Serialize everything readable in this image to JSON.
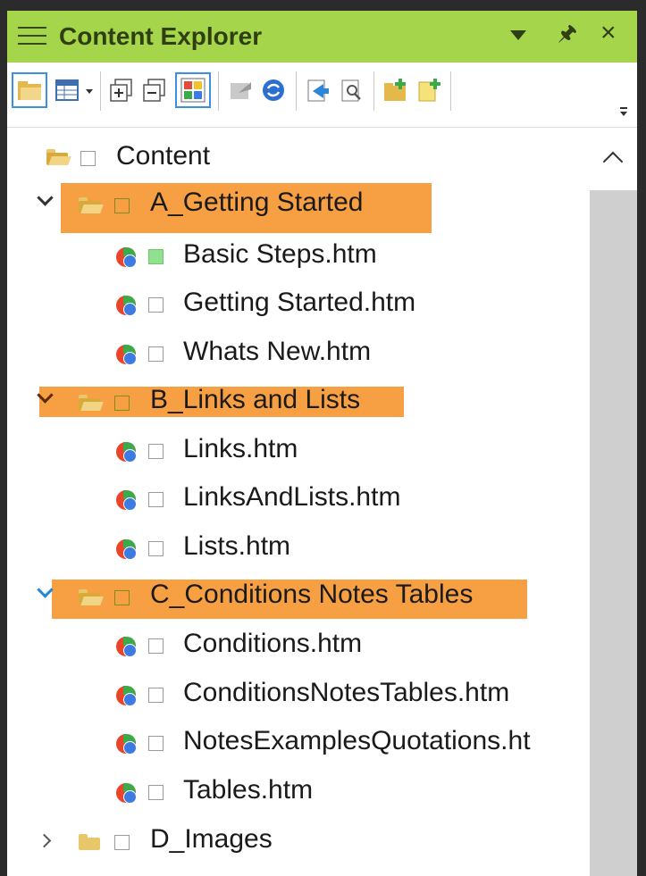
{
  "panel": {
    "title": "Content Explorer",
    "title_buttons": [
      "dropdown-icon",
      "pin-icon",
      "close-icon"
    ]
  },
  "toolbar": {
    "buttons": [
      "new-folder-icon",
      "view-options-icon",
      "expand-all-icon",
      "collapse-all-icon",
      "color-grid-icon",
      "disabled-arrow-icon",
      "refresh-icon",
      "export-icon",
      "find-icon",
      "add-folder-icon",
      "add-file-icon"
    ]
  },
  "tree": {
    "root": {
      "label": "Content"
    },
    "folders": [
      {
        "label": "A_Getting Started",
        "expanded": true,
        "highlighted": true,
        "files": [
          {
            "label": "Basic Steps.htm",
            "checked_color": "#8fe08f"
          },
          {
            "label": "Getting Started.htm"
          },
          {
            "label": "Whats New.htm"
          }
        ]
      },
      {
        "label": "B_Links and Lists",
        "expanded": true,
        "highlighted": true,
        "files": [
          {
            "label": "Links.htm"
          },
          {
            "label": "LinksAndLists.htm"
          },
          {
            "label": "Lists.htm"
          }
        ]
      },
      {
        "label": "C_Conditions Notes Tables",
        "expanded": true,
        "highlighted": true,
        "files": [
          {
            "label": "Conditions.htm"
          },
          {
            "label": "ConditionsNotesTables.htm"
          },
          {
            "label": "NotesExamplesQuotations.ht"
          },
          {
            "label": "Tables.htm"
          }
        ]
      },
      {
        "label": "D_Images",
        "expanded": false,
        "highlighted": false
      }
    ]
  },
  "colors": {
    "title_bar": "#a5d54a",
    "highlight": "#f7a043",
    "selection_outline": "#3d8fe0"
  }
}
